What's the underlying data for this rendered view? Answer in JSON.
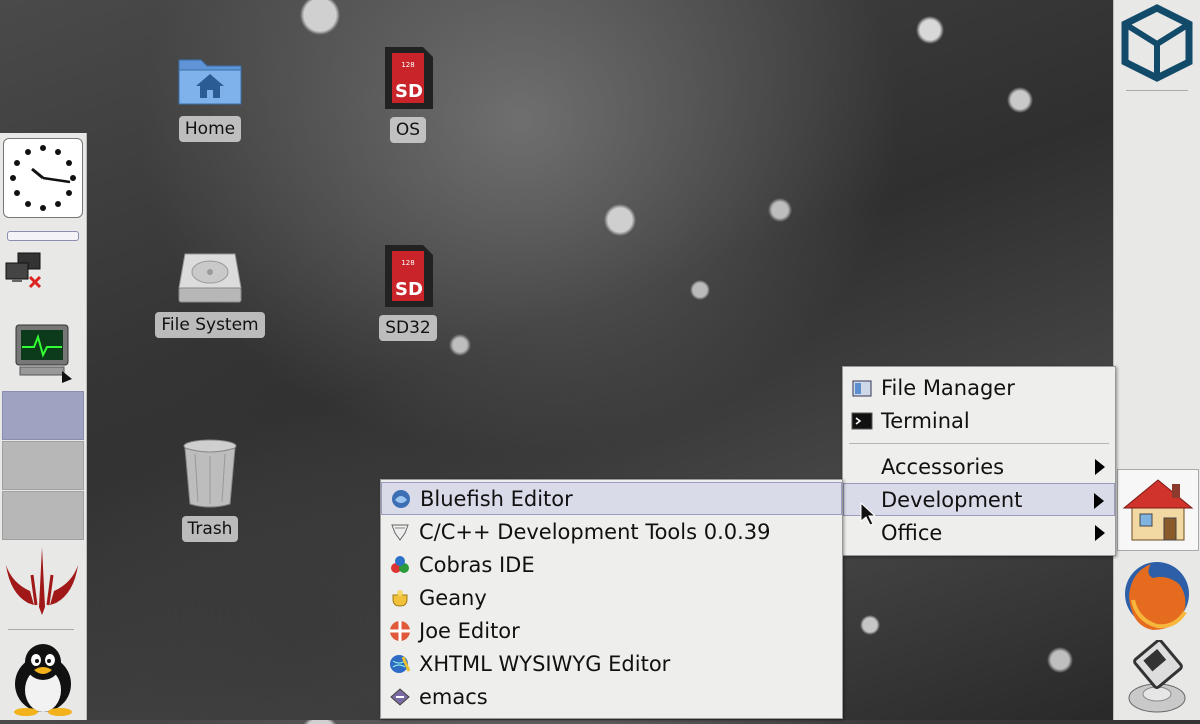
{
  "desktop": {
    "icons": [
      {
        "label": "Home"
      },
      {
        "label": "OS",
        "badge": "SD",
        "size": "128"
      },
      {
        "label": "File System"
      },
      {
        "label": "SD32",
        "badge": "SD",
        "size": "128"
      },
      {
        "label": "Trash"
      }
    ]
  },
  "main_menu": {
    "items": [
      {
        "label": "File Manager",
        "icon": "folder-icon"
      },
      {
        "label": "Terminal",
        "icon": "terminal-icon"
      },
      {
        "label": "Accessories",
        "submenu": true
      },
      {
        "label": "Development",
        "submenu": true,
        "highlighted": true
      },
      {
        "label": "Office",
        "submenu": true
      }
    ]
  },
  "dev_menu": {
    "items": [
      {
        "label": "Bluefish Editor",
        "icon": "bluefish-icon",
        "highlighted": true
      },
      {
        "label": "C/C++ Development Tools 0.0.39",
        "icon": "cpp-tools-icon"
      },
      {
        "label": "Cobras IDE",
        "icon": "cobras-icon"
      },
      {
        "label": "Geany",
        "icon": "geany-icon"
      },
      {
        "label": "Joe Editor",
        "icon": "joe-icon"
      },
      {
        "label": "XHTML WYSIWYG Editor",
        "icon": "xhtml-editor-icon"
      },
      {
        "label": "emacs",
        "icon": "emacs-icon"
      }
    ]
  },
  "left_panel": {
    "items": [
      "clock-icon",
      "network-disconnected-icon",
      "system-monitor-icon",
      "quake-icon",
      "tux-icon"
    ]
  },
  "right_panel": {
    "items": [
      "cube-logo-icon",
      "home-house-icon",
      "firefox-icon",
      "disk-mount-icon"
    ]
  },
  "colors": {
    "menu_bg": "#eeeeec",
    "highlight": "#d9dbe9",
    "pager_active": "#9fa2c0"
  }
}
